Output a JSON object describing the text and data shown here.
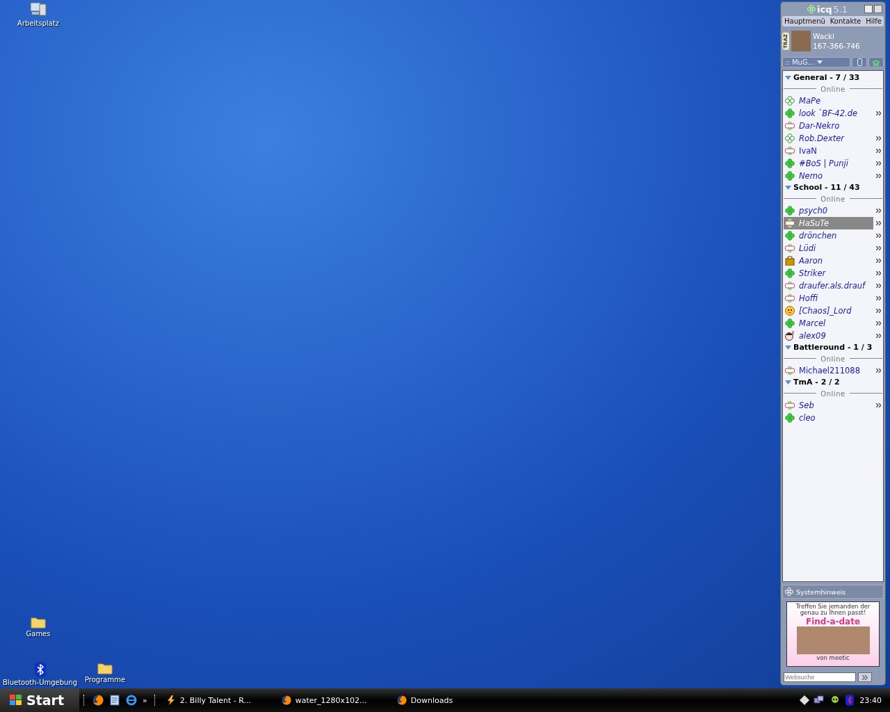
{
  "desktop_icons": [
    {
      "label": "Arbeitsplatz",
      "kind": "computer"
    },
    {
      "label": "Games",
      "kind": "folder"
    },
    {
      "label": "Bluetooth-Umgebung",
      "kind": "bluetooth"
    },
    {
      "label": "Programme",
      "kind": "folder"
    }
  ],
  "icq": {
    "logo": "icq",
    "version": "5.1",
    "menu": [
      "Hauptmenü",
      "Kontakte",
      "Hilfe"
    ],
    "side_tab": "TRAZ",
    "profile": {
      "name": "Wacki",
      "number": "167-366-746"
    },
    "status_dropdown": ":: MuG...",
    "groups": [
      {
        "label": "General - 7 / 33",
        "expanded": true,
        "section": "Online",
        "contacts": [
          {
            "name": "MaPe",
            "kind": "free",
            "italic": true,
            "more": false,
            "selected": false
          },
          {
            "name": "look `BF-42.de",
            "kind": "online",
            "italic": true,
            "more": true,
            "selected": false
          },
          {
            "name": "Dar-Nekro",
            "kind": "na",
            "italic": true,
            "more": false,
            "selected": false
          },
          {
            "name": "Rob.Dexter",
            "kind": "free",
            "italic": true,
            "more": true,
            "selected": false
          },
          {
            "name": "IvaN",
            "kind": "na",
            "italic": false,
            "more": true,
            "selected": false
          },
          {
            "name": "#BoS | Punji",
            "kind": "online",
            "italic": true,
            "more": true,
            "selected": false
          },
          {
            "name": "Nemo",
            "kind": "online",
            "italic": true,
            "more": true,
            "selected": false
          }
        ]
      },
      {
        "label": "School - 11 / 43",
        "expanded": true,
        "section": "Online",
        "contacts": [
          {
            "name": "psych0",
            "kind": "online",
            "italic": true,
            "more": true,
            "selected": false
          },
          {
            "name": "HaSuTe",
            "kind": "na",
            "italic": true,
            "more": true,
            "selected": true
          },
          {
            "name": "drönchen",
            "kind": "online",
            "italic": true,
            "more": true,
            "selected": false
          },
          {
            "name": "Lüdi",
            "kind": "na",
            "italic": true,
            "more": true,
            "selected": false
          },
          {
            "name": "Aaron",
            "kind": "bag",
            "italic": true,
            "more": true,
            "selected": false
          },
          {
            "name": "Striker",
            "kind": "online",
            "italic": true,
            "more": true,
            "selected": false
          },
          {
            "name": "draufer.als.drauf",
            "kind": "na",
            "italic": true,
            "more": true,
            "selected": false
          },
          {
            "name": "Hoffi",
            "kind": "na",
            "italic": true,
            "more": true,
            "selected": false
          },
          {
            "name": "[Chaos]_Lord",
            "kind": "smiley",
            "italic": true,
            "more": true,
            "selected": false
          },
          {
            "name": "Marcel",
            "kind": "online",
            "italic": true,
            "more": true,
            "selected": false
          },
          {
            "name": "alex09",
            "kind": "sleepy",
            "italic": true,
            "more": true,
            "selected": false
          }
        ]
      },
      {
        "label": "Battleround - 1 / 3",
        "expanded": true,
        "section": "Online",
        "contacts": [
          {
            "name": "Michael211088",
            "kind": "na",
            "italic": false,
            "more": true,
            "selected": false
          }
        ]
      },
      {
        "label": "TmA - 2 / 2",
        "expanded": true,
        "section": "Online",
        "contacts": [
          {
            "name": "Seb",
            "kind": "na",
            "italic": true,
            "more": true,
            "selected": false
          },
          {
            "name": "cleo",
            "kind": "online",
            "italic": true,
            "more": false,
            "selected": false
          }
        ]
      }
    ],
    "notice": "Systemhinweis",
    "ad": {
      "text": "Treffen Sie jemanden der genau zu Ihnen passt!",
      "headline": "Find-a-date",
      "footer": "von meetic"
    },
    "search": {
      "placeholder": "Websuche"
    }
  },
  "taskbar": {
    "start": "Start",
    "overflow": "»",
    "tasks": [
      "2. Billy Talent - R...",
      "water_1280x102...",
      "Downloads"
    ],
    "clock": "23:40"
  }
}
